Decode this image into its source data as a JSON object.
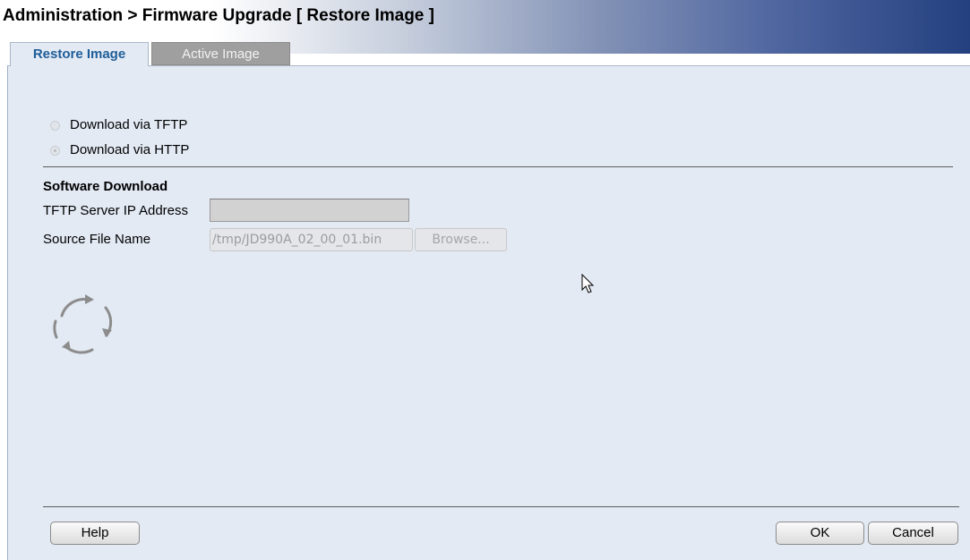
{
  "header": {
    "title": "Administration > Firmware Upgrade [ Restore Image ]"
  },
  "tabs": [
    {
      "label": "Restore Image",
      "active": true
    },
    {
      "label": "Active Image",
      "active": false
    }
  ],
  "download_options": [
    {
      "label": "Download via TFTP",
      "checked": false
    },
    {
      "label": "Download via HTTP",
      "checked": true
    }
  ],
  "software_download": {
    "section_title": "Software Download",
    "tftp_server_label": "TFTP Server IP Address",
    "tftp_server_value": "",
    "source_file_label": "Source File Name",
    "source_file_value": "/tmp/JD990A_02_00_01.bin",
    "browse_label": "Browse..."
  },
  "footer": {
    "help_label": "Help",
    "ok_label": "OK",
    "cancel_label": "Cancel"
  },
  "icons": {
    "spinner": "loading-spinner-icon",
    "cursor": "mouse-pointer-icon"
  },
  "colors": {
    "panel_background": "#e3eaf4",
    "active_tab_text": "#1f5d98",
    "inactive_tab_background": "#9f9f9f",
    "header_gradient_end": "#24407f"
  }
}
